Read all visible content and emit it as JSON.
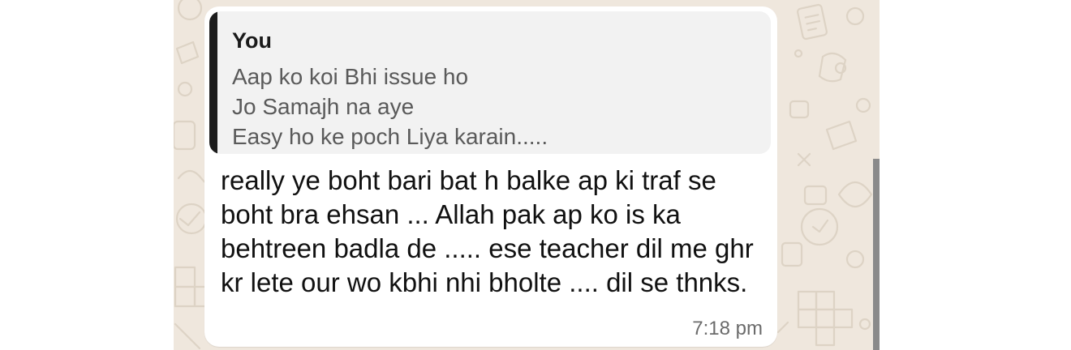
{
  "chat": {
    "message": {
      "quoted": {
        "author": "You",
        "lines": [
          "Aap ko koi Bhi issue ho",
          "Jo Samajh na aye",
          "Easy ho ke poch Liya karain....."
        ]
      },
      "text": "really ye boht bari bat h balke ap ki traf se boht bra ehsan ... Allah pak ap ko is ka behtreen badla de ..... ese teacher dil me ghr kr lete our wo kbhi nhi bholte .... dil se thnks.",
      "time": "7:18 pm"
    }
  },
  "colors": {
    "wallpaper": "#efe7dd",
    "bubble": "#ffffff",
    "quote_background": "#f2f2f2",
    "quote_bar": "#1c1c1c"
  }
}
